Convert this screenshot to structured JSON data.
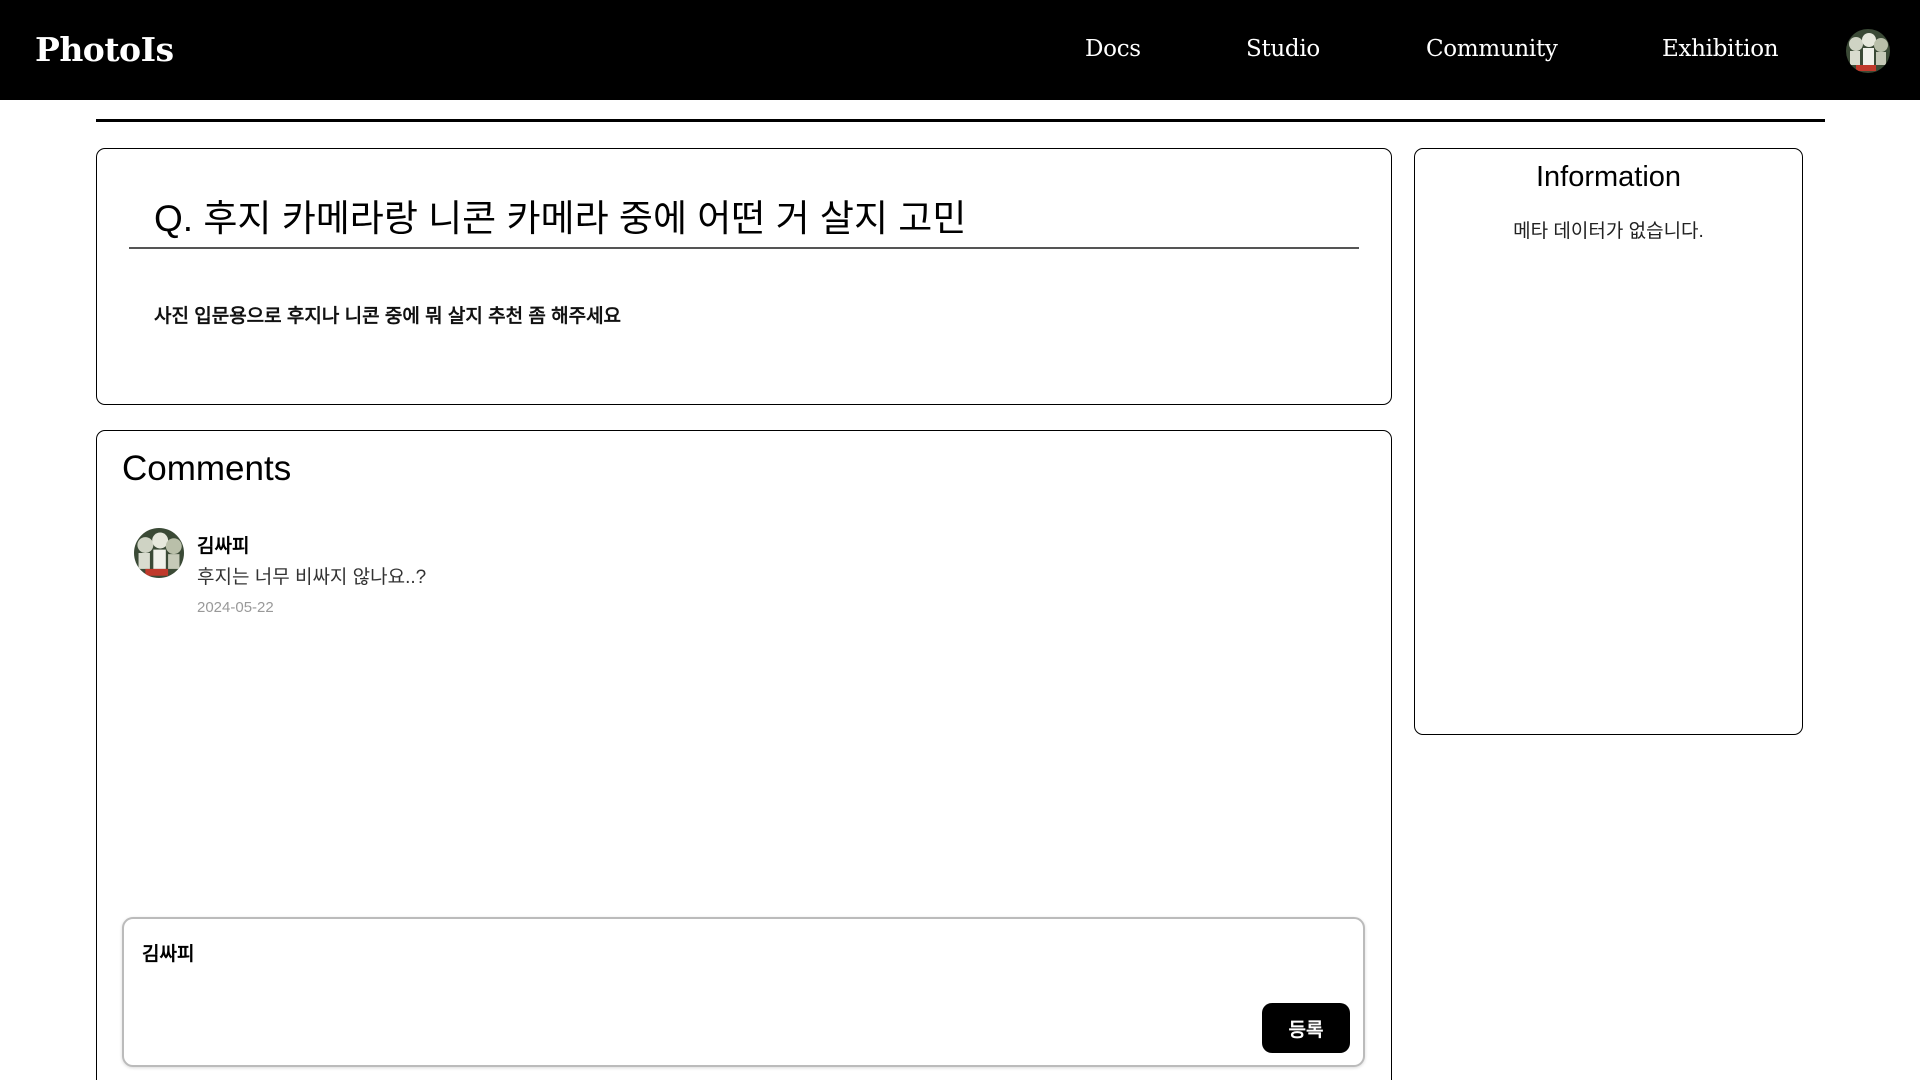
{
  "header": {
    "logo": "PhotoIs",
    "nav": {
      "docs": "Docs",
      "studio": "Studio",
      "community": "Community",
      "exhibition": "Exhibition"
    }
  },
  "question": {
    "title": "Q. 후지 카메라랑 니콘 카메라 중에 어떤 거 살지 고민",
    "body": "사진 입문용으로 후지나 니콘 중에 뭐 살지 추천 좀 해주세요"
  },
  "comments": {
    "heading": "Comments",
    "items": [
      {
        "author": "김싸피",
        "text": "후지는 너무 비싸지 않나요..?",
        "date": "2024-05-22"
      }
    ],
    "input": {
      "author": "김싸피",
      "value": "",
      "submit_label": "등록"
    }
  },
  "information": {
    "title": "Information",
    "text": "메타 데이터가 없습니다."
  },
  "colors": {
    "header_bg": "#000000",
    "accent": "#000000",
    "date_text": "#999999"
  }
}
